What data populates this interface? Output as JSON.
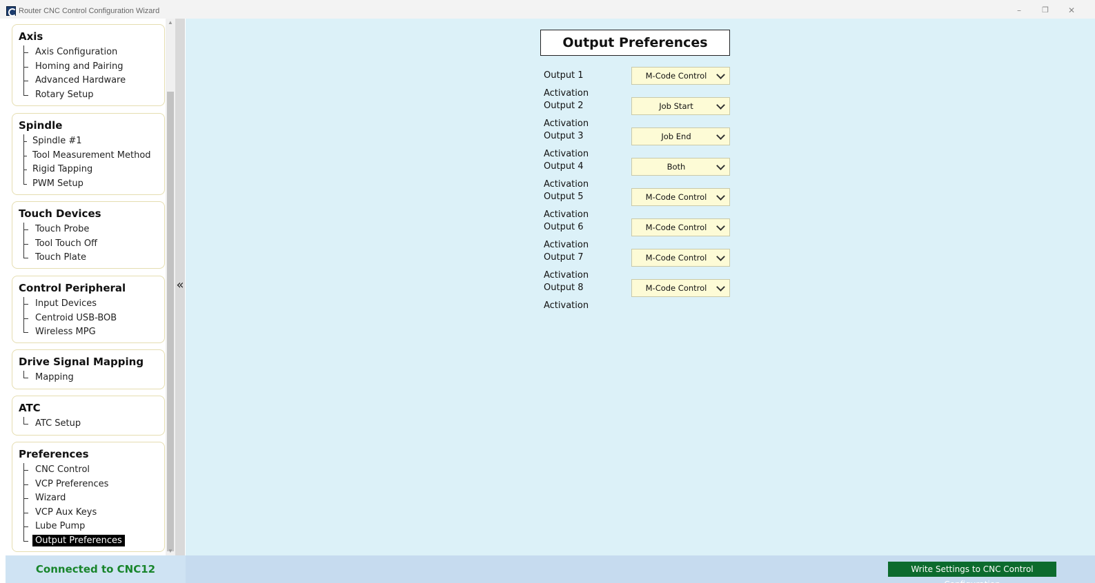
{
  "window": {
    "title": "Router CNC Control Configuration Wizard",
    "minimize_icon": "minimize-icon",
    "restore_icon": "restore-icon",
    "close_icon": "close-icon"
  },
  "sidebar": {
    "collapse_icon": "double-chevron-left-icon",
    "panels": [
      {
        "title": "Axis",
        "items": [
          "Axis Configuration",
          "Homing and Pairing",
          "Advanced Hardware",
          "Rotary Setup"
        ]
      },
      {
        "title": "Spindle",
        "items": [
          "Spindle #1",
          "Tool Measurement Method",
          "Rigid Tapping",
          "PWM Setup"
        ]
      },
      {
        "title": "Touch Devices",
        "items": [
          "Touch Probe",
          "Tool Touch Off",
          "Touch Plate"
        ]
      },
      {
        "title": "Control Peripheral",
        "items": [
          "Input Devices",
          "Centroid USB-BOB",
          "Wireless MPG"
        ]
      },
      {
        "title": "Drive Signal Mapping",
        "items": [
          "Mapping"
        ]
      },
      {
        "title": "ATC",
        "items": [
          "ATC Setup"
        ]
      },
      {
        "title": "Preferences",
        "items": [
          "CNC Control",
          "VCP Preferences",
          "Wizard",
          "VCP Aux Keys",
          "Lube Pump",
          "Output Preferences"
        ]
      }
    ],
    "selected": "Output Preferences"
  },
  "main": {
    "title": "Output Preferences",
    "rows": [
      {
        "label": "Output 1 Activation",
        "value": "M-Code Control"
      },
      {
        "label": "Output 2 Activation",
        "value": "Job Start"
      },
      {
        "label": "Output 3 Activation",
        "value": "Job End"
      },
      {
        "label": "Output 4 Activation",
        "value": "Both"
      },
      {
        "label": "Output 5 Activation",
        "value": "M-Code Control"
      },
      {
        "label": "Output 6 Activation",
        "value": "M-Code Control"
      },
      {
        "label": "Output 7 Activation",
        "value": "M-Code Control"
      },
      {
        "label": "Output 8 Activation",
        "value": "M-Code Control"
      }
    ]
  },
  "status": {
    "connection": "Connected to CNC12",
    "write_button": "Write Settings to CNC Control Configuration"
  },
  "colors": {
    "main_bg": "#dcf1f8",
    "dropdown_bg": "#fdfbd6",
    "connected_text": "#18852b",
    "write_button_bg": "#0c6b2d"
  }
}
